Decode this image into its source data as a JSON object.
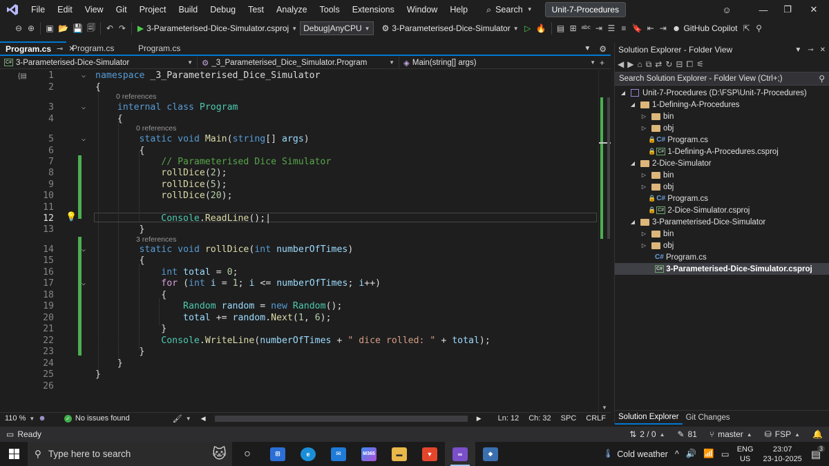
{
  "menu": {
    "items": [
      "File",
      "Edit",
      "View",
      "Git",
      "Project",
      "Build",
      "Debug",
      "Test",
      "Analyze",
      "Tools",
      "Extensions",
      "Window",
      "Help"
    ],
    "search_label": "Search",
    "solution_name": "Unit-7-Procedures"
  },
  "toolbar": {
    "startup_project": "3-Parameterised-Dice-Simulator.csproj",
    "configuration": "Debug|AnyCPU",
    "run_target": "3-Parameterised-Dice-Simulator",
    "copilot_label": "GitHub Copilot"
  },
  "tabs": [
    {
      "label": "Program.cs",
      "active": true
    },
    {
      "label": "Program.cs",
      "active": false
    },
    {
      "label": "Program.cs",
      "active": false
    }
  ],
  "navbar": {
    "project": "3-Parameterised-Dice-Simulator",
    "type": "_3_Parameterised_Dice_Simulator.Program",
    "member": "Main(string[] args)"
  },
  "code": {
    "current_line": 12,
    "line_numbers": [
      "1",
      "2",
      "3",
      "4",
      "5",
      "6",
      "7",
      "8",
      "9",
      "10",
      "11",
      "12",
      "13",
      "14",
      "15",
      "16",
      "17",
      "18",
      "19",
      "20",
      "21",
      "22",
      "23",
      "24",
      "25",
      "26"
    ],
    "refs": {
      "class": "0 references",
      "main": "0 references",
      "rolldice": "3 references"
    }
  },
  "editor_status": {
    "zoom": "110 %",
    "issues": "No issues found",
    "line": "Ln: 12",
    "char": "Ch: 32",
    "whitespace": "SPC",
    "line_ending": "CRLF"
  },
  "solution_explorer": {
    "title": "Solution Explorer - Folder View",
    "search_placeholder": "Search Solution Explorer - Folder View (Ctrl+;)",
    "tree": [
      {
        "label": "Unit-7-Procedures (D:\\FSP\\Unit-7-Procedures)",
        "kind": "solution",
        "expanded": true
      },
      {
        "label": "1-Defining-A-Procedures",
        "kind": "folder",
        "expanded": true
      },
      {
        "label": "bin",
        "kind": "folder",
        "expanded": false
      },
      {
        "label": "obj",
        "kind": "folder",
        "expanded": false
      },
      {
        "label": "Program.cs",
        "kind": "cs",
        "locked": true
      },
      {
        "label": "1-Defining-A-Procedures.csproj",
        "kind": "csproj",
        "locked": true
      },
      {
        "label": "2-Dice-Simulator",
        "kind": "folder",
        "expanded": true
      },
      {
        "label": "bin",
        "kind": "folder",
        "expanded": false
      },
      {
        "label": "obj",
        "kind": "folder",
        "expanded": false
      },
      {
        "label": "Program.cs",
        "kind": "cs",
        "locked": true
      },
      {
        "label": "2-Dice-Simulator.csproj",
        "kind": "csproj",
        "locked": true
      },
      {
        "label": "3-Parameterised-Dice-Simulator",
        "kind": "folder",
        "expanded": true
      },
      {
        "label": "bin",
        "kind": "folder",
        "expanded": false
      },
      {
        "label": "obj",
        "kind": "folder",
        "expanded": false
      },
      {
        "label": "Program.cs",
        "kind": "cs",
        "locked": false
      },
      {
        "label": "3-Parameterised-Dice-Simulator.csproj",
        "kind": "csproj",
        "locked": false,
        "selected": true
      }
    ],
    "tabs": [
      "Solution Explorer",
      "Git Changes"
    ]
  },
  "statusbar": {
    "state": "Ready",
    "commits": "2 / 0",
    "changes": "81",
    "branch": "master",
    "repo": "FSP"
  },
  "taskbar": {
    "search_placeholder": "Type here to search",
    "weather": "Cold weather",
    "language": "ENG",
    "region": "US",
    "time": "23:07",
    "date": "23-10-2025",
    "notification_count": "3",
    "m365_label": "M365"
  },
  "colors": {
    "accent": "#0078d4",
    "change_bar": "#4caf50",
    "solution_badge_bg": "#3a3d41"
  }
}
